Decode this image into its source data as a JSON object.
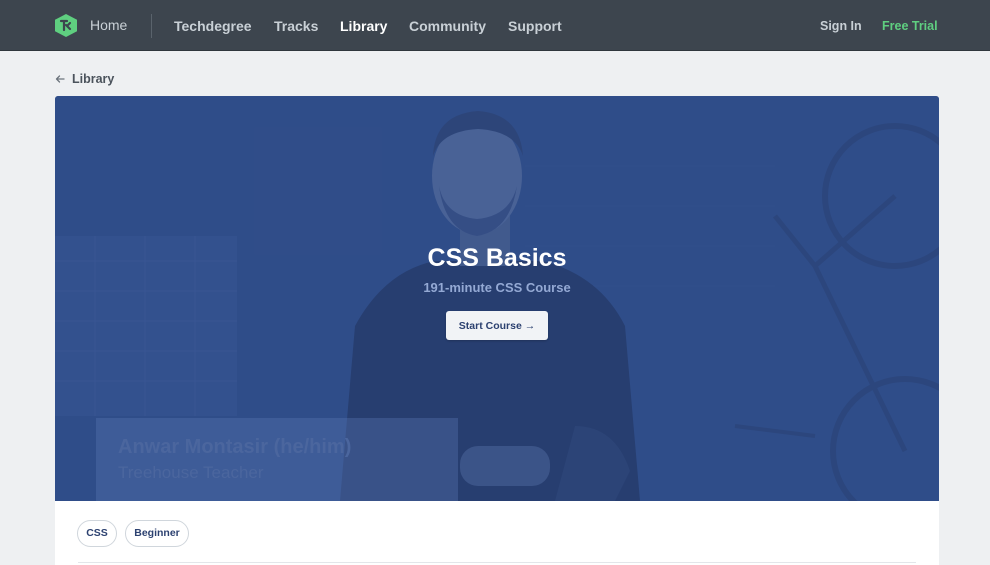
{
  "nav": {
    "home": "Home",
    "links": [
      "Techdegree",
      "Tracks",
      "Library",
      "Community",
      "Support"
    ],
    "active": "Library",
    "sign_in": "Sign In",
    "free_trial": "Free Trial"
  },
  "breadcrumb": {
    "icon": "arrow-left-icon",
    "label": "Library"
  },
  "hero": {
    "title": "CSS Basics",
    "subtitle": "191-minute CSS Course",
    "start_button": "Start Course →",
    "teacher_name": "Anwar Montasir (he/him)",
    "teacher_role": "Treehouse Teacher"
  },
  "tags": [
    "CSS",
    "Beginner"
  ],
  "colors": {
    "nav_bg": "#3d454e",
    "accent_green": "#5fcf80",
    "hero_blue": "#32508a",
    "page_bg": "#eef0f2"
  }
}
